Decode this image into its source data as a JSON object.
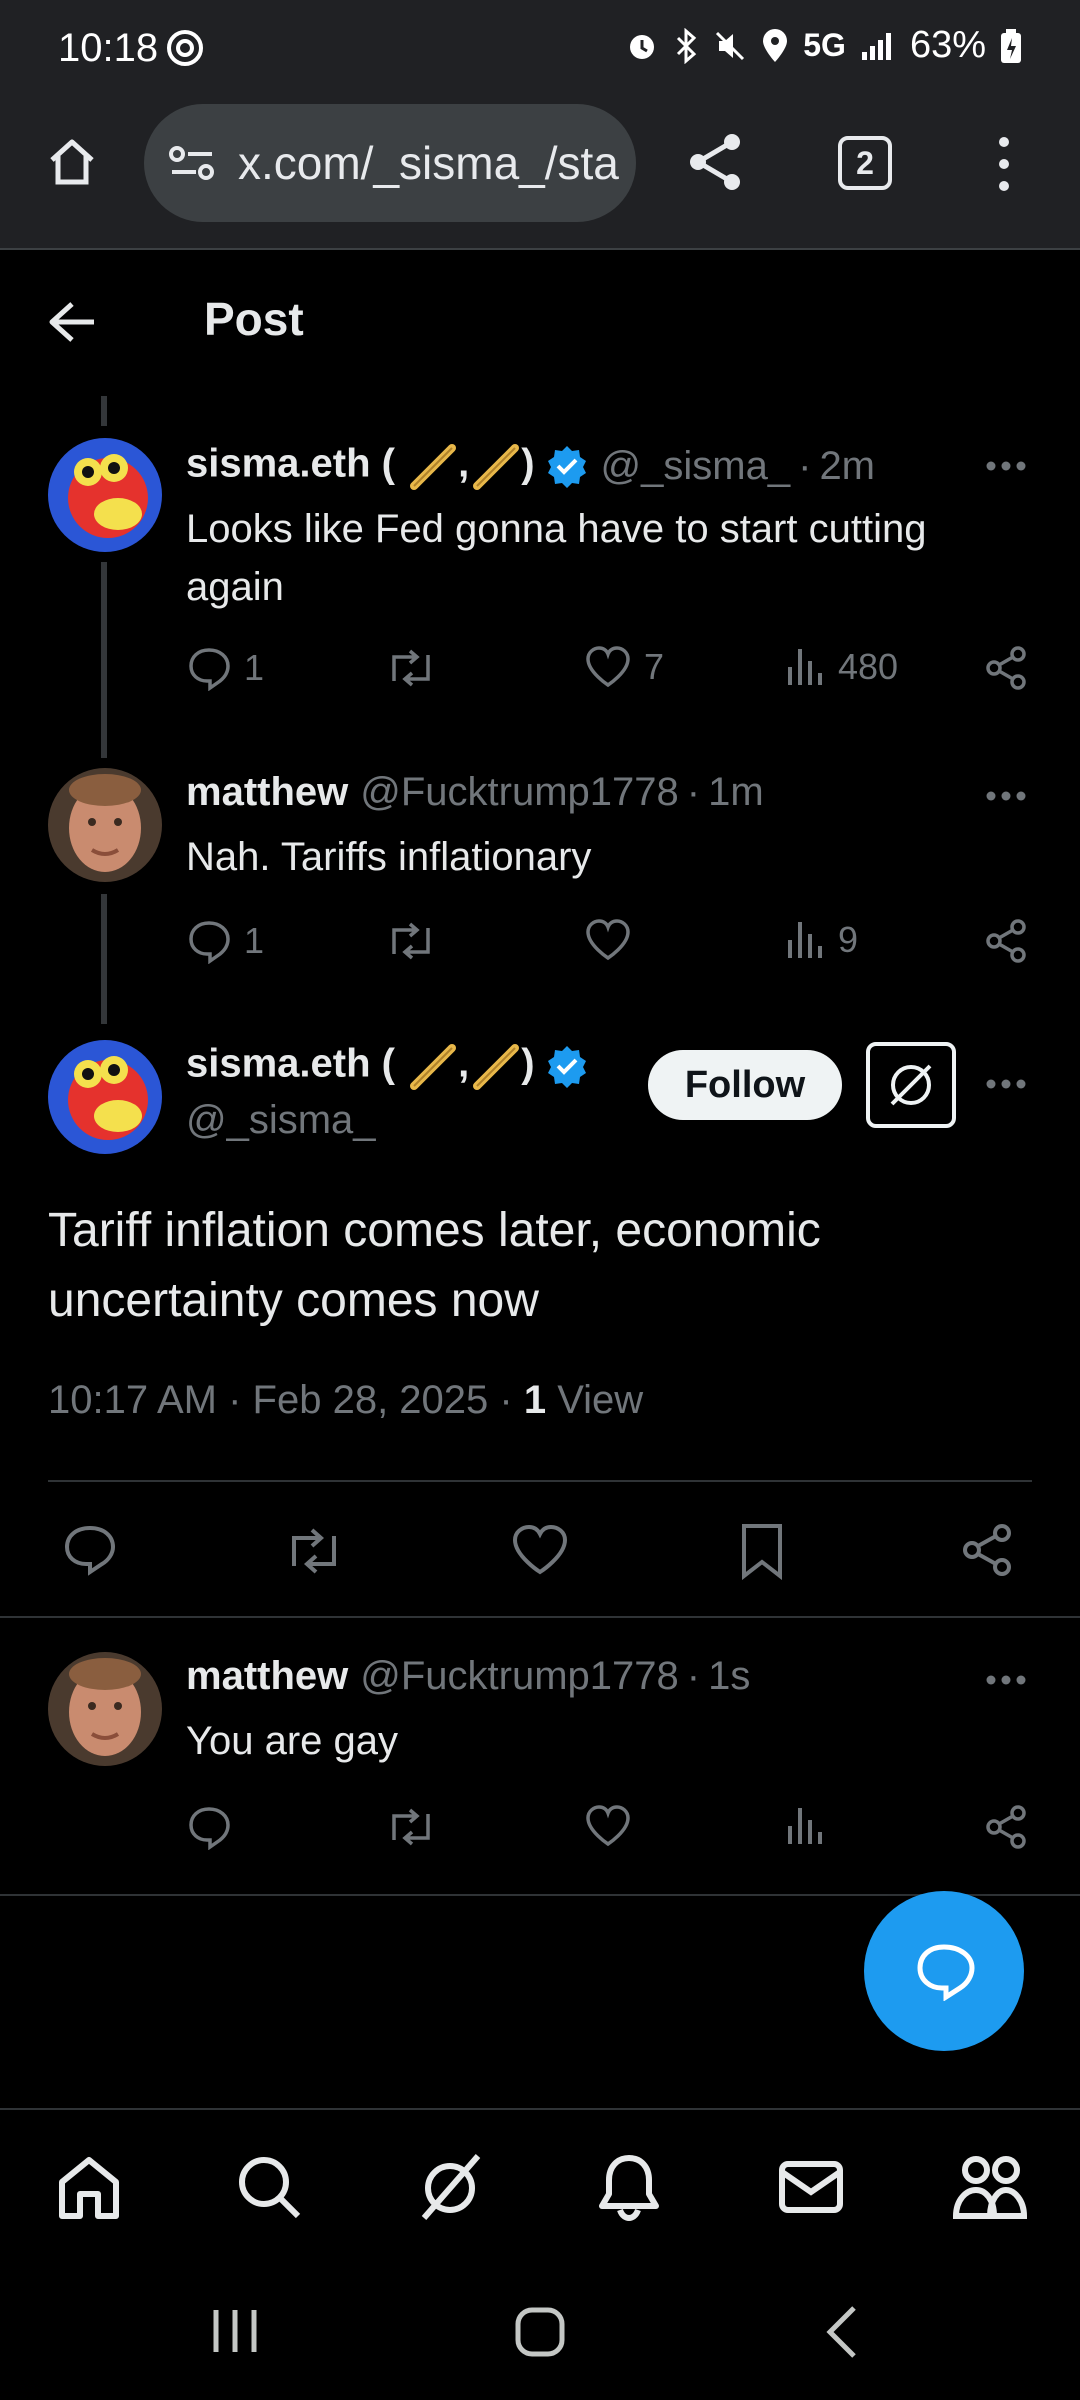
{
  "status_bar": {
    "time": "10:18",
    "network": "5G",
    "battery": "63%"
  },
  "browser": {
    "url": "x.com/_sisma_/sta",
    "tab_count": "2"
  },
  "header": {
    "title": "Post"
  },
  "tweets": [
    {
      "name": "sisma.eth (",
      "name_suffix": ")",
      "handle": "@_sisma_",
      "time": "2m",
      "text": "Looks like Fed gonna have to start cutting again",
      "replies": "1",
      "likes": "7",
      "views": "480"
    },
    {
      "name": "matthew",
      "handle": "@Fucktrump1778",
      "time": "1m",
      "text": "Nah. Tariffs inflationary",
      "replies": "1",
      "views": "9"
    },
    {
      "name": "matthew",
      "handle": "@Fucktrump1778",
      "time": "1s",
      "text": "You are gay"
    }
  ],
  "main_post": {
    "name": "sisma.eth (",
    "name_suffix": ")",
    "handle": "@_sisma_",
    "follow_label": "Follow",
    "text": "Tariff inflation comes later, economic uncertainty comes now",
    "timestamp": "10:17 AM · Feb 28, 2025 · ",
    "views_count": "1",
    "views_label": " View"
  },
  "colors": {
    "accent": "#1d9bf0",
    "background": "#000000",
    "secondary_text": "#71767b"
  },
  "icons": [
    "home-icon",
    "search-icon",
    "grok-icon",
    "notifications-icon",
    "messages-icon",
    "communities-icon"
  ]
}
